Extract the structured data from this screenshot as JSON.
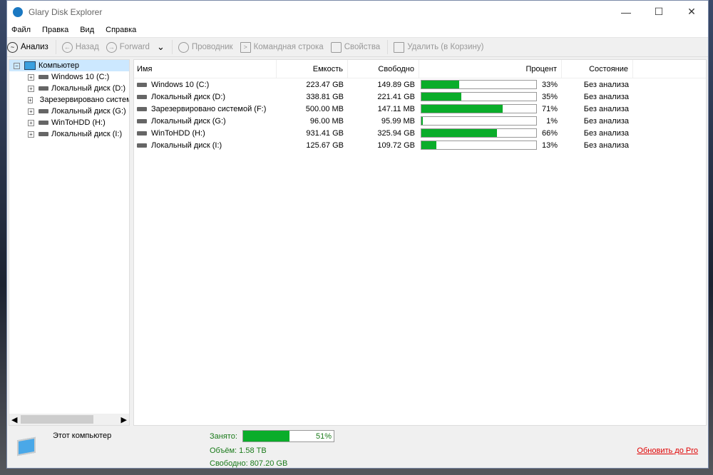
{
  "title": "Glary Disk Explorer",
  "menu": [
    "Файл",
    "Правка",
    "Вид",
    "Справка"
  ],
  "toolbar": {
    "analyze": "Анализ",
    "back": "Назад",
    "forward": "Forward",
    "explorer": "Проводник",
    "cmd": "Командная строка",
    "props": "Свойства",
    "delete": "Удалить (в Корзину)"
  },
  "tree": {
    "root": "Компьютер",
    "items": [
      "Windows 10 (C:)",
      "Локальный диск (D:)",
      "Зарезервировано системой (F:)",
      "Локальный диск (G:)",
      "WinToHDD (H:)",
      "Локальный диск (I:)"
    ]
  },
  "columns": {
    "name": "Имя",
    "capacity": "Емкость",
    "free": "Свободно",
    "percent": "Процент",
    "state": "Состояние"
  },
  "rows": [
    {
      "name": "Windows 10 (C:)",
      "capacity": "223.47 GB",
      "free": "149.89 GB",
      "percent": "33%",
      "pct": 33,
      "state": "Без анализа"
    },
    {
      "name": "Локальный диск (D:)",
      "capacity": "338.81 GB",
      "free": "221.41 GB",
      "percent": "35%",
      "pct": 35,
      "state": "Без анализа"
    },
    {
      "name": "Зарезервировано системой (F:)",
      "capacity": "500.00 MB",
      "free": "147.11 MB",
      "percent": "71%",
      "pct": 71,
      "state": "Без анализа"
    },
    {
      "name": "Локальный диск (G:)",
      "capacity": "96.00 MB",
      "free": "95.99 MB",
      "percent": "1%",
      "pct": 1,
      "state": "Без анализа"
    },
    {
      "name": "WinToHDD (H:)",
      "capacity": "931.41 GB",
      "free": "325.94 GB",
      "percent": "66%",
      "pct": 66,
      "state": "Без анализа"
    },
    {
      "name": "Локальный диск (I:)",
      "capacity": "125.67 GB",
      "free": "109.72 GB",
      "percent": "13%",
      "pct": 13,
      "state": "Без анализа"
    }
  ],
  "status": {
    "name": "Этот компьютер",
    "used_label": "Занято:",
    "used_percent": "51%",
    "used_pct": 51,
    "volume": "Объём: 1.58 TB",
    "free": "Свободно: 807.20 GB",
    "upgrade": "Обновить до Pro"
  },
  "colors": {
    "bar": "#0aad2a",
    "link": "#e00000"
  }
}
